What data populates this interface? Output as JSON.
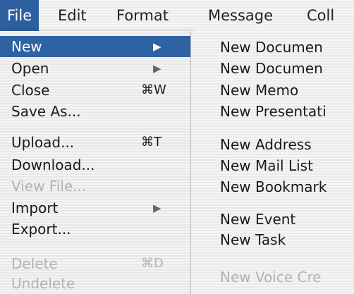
{
  "menubar": {
    "file": "File",
    "edit": "Edit",
    "format": "Format",
    "message": "Message",
    "coll": "Coll"
  },
  "file_menu": {
    "new": {
      "label": "New"
    },
    "open": {
      "label": "Open"
    },
    "close": {
      "label": "Close",
      "shortcut": "⌘W"
    },
    "save_as": {
      "label": "Save As..."
    },
    "upload": {
      "label": "Upload...",
      "shortcut": "⌘T"
    },
    "download": {
      "label": "Download..."
    },
    "view_file": {
      "label": "View File..."
    },
    "import": {
      "label": "Import"
    },
    "export": {
      "label": "Export..."
    },
    "delete": {
      "label": "Delete",
      "shortcut": "⌘D"
    },
    "undelete": {
      "label": "Undelete"
    }
  },
  "new_submenu": {
    "new_document_1": "New Documen",
    "new_document_2": "New Documen",
    "new_memo": "New Memo",
    "new_presentation": "New Presentati",
    "new_address": "New Address",
    "new_mail_list": "New Mail List",
    "new_bookmark": "New Bookmark",
    "new_event": "New Event",
    "new_task": "New Task",
    "new_voice": "New Voice Cre"
  },
  "colors": {
    "highlight": "#2f62a3",
    "disabled_text": "#b3b3b3"
  }
}
